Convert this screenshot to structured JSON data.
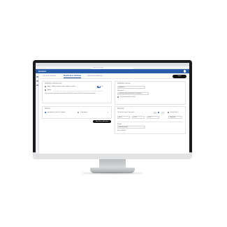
{
  "browser": {
    "url": "app.com/settings"
  },
  "app": {
    "brand": "Generic"
  },
  "nav": {
    "tabs": [
      "General Settings",
      "Notification Settings",
      "Advanced Settings"
    ],
    "active_tab": "Notification Settings",
    "save_label": "Save"
  },
  "left": {
    "section1_title": "Notification Preferences",
    "option1": "Alert - Notify members when update is made",
    "option1_value": "On",
    "option2": "Apply",
    "description": "Send an email to the team and include all affected records related to this notification update.",
    "section2_title": "Delivery",
    "select1": "Immediately after the update",
    "select2": "Daily digest",
    "action_label": "Send test notification"
  },
  "right": {
    "section1_title": "Notification Group",
    "group_value": "Members",
    "label2": "Recipients",
    "recipients_value": "Selected users and teams in the group",
    "checkbox_label": "Include external contacts",
    "section2_title": "Schedule",
    "schedule_select": "On the first day of the week",
    "schedule_right": "Every Week",
    "times": [
      "08:00",
      "12:00",
      "16:00"
    ],
    "times_right": "Timezone",
    "footer_label": "Priority",
    "footer_select": "Normal priority",
    "footer_extra": "Set as default"
  },
  "colors": {
    "accent": "#2a5da8",
    "bezel": "#1c1c1e"
  }
}
